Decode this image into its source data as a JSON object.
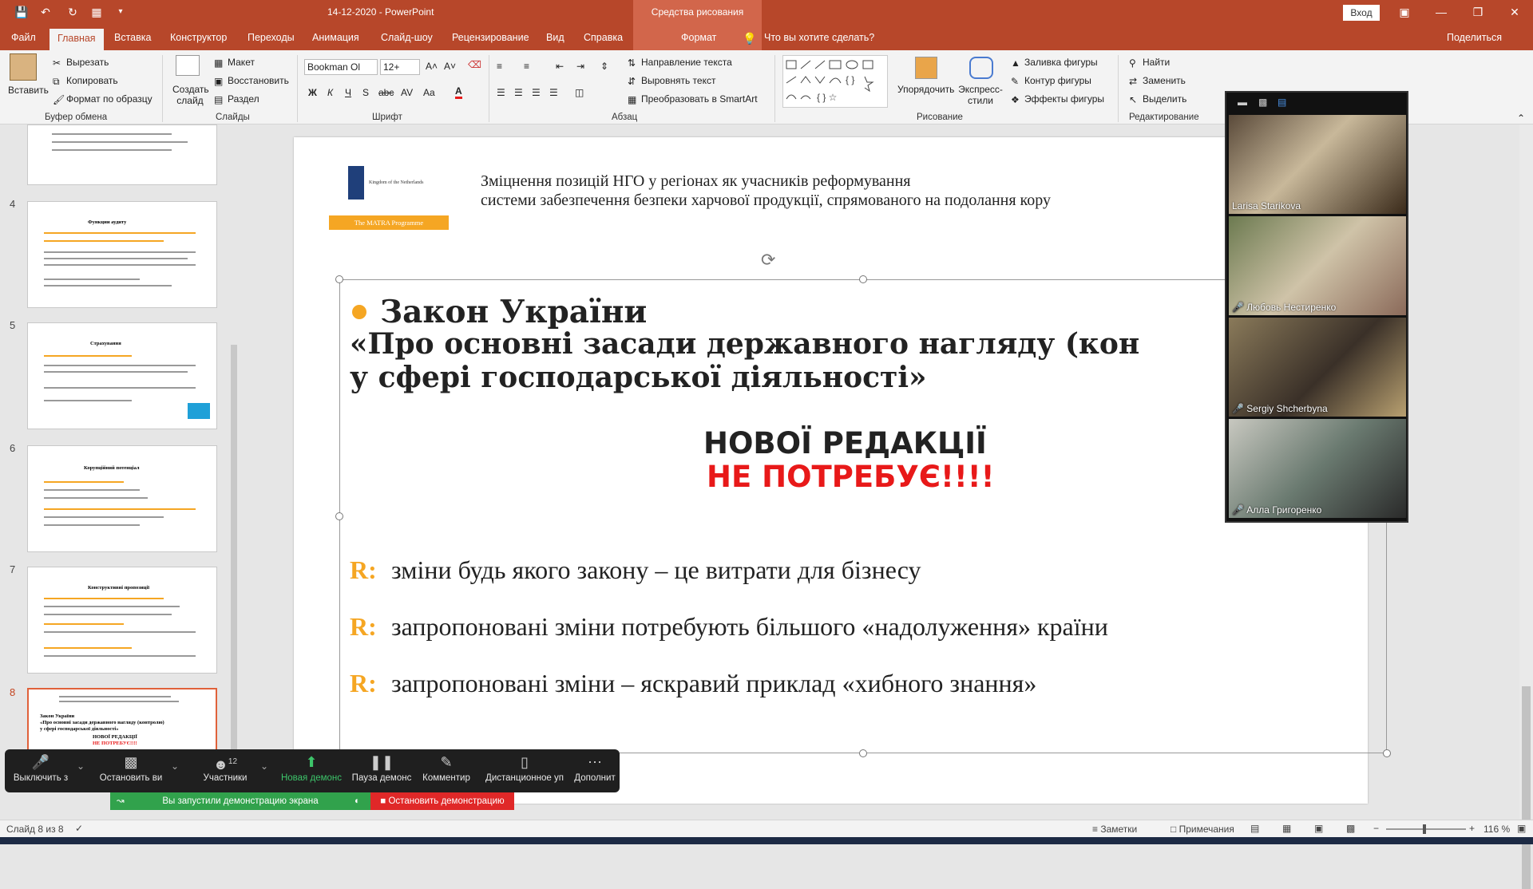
{
  "window": {
    "title": "14-12-2020  -  PowerPoint",
    "context_tab": "Средства рисования",
    "login": "Вход"
  },
  "menu": {
    "tabs": [
      "Файл",
      "Главная",
      "Вставка",
      "Конструктор",
      "Переходы",
      "Анимация",
      "Слайд-шоу",
      "Рецензирование",
      "Вид",
      "Справка"
    ],
    "format": "Формат",
    "tell_me": "Что вы хотите сделать?",
    "share": "Поделиться"
  },
  "ribbon": {
    "paste": "Вставить",
    "cut": "Вырезать",
    "copy": "Копировать",
    "format_painter": "Формат по образцу",
    "clipboard": "Буфер обмена",
    "new_slide": "Создать слайд",
    "layout": "Макет",
    "reset": "Восстановить",
    "section": "Раздел",
    "slides": "Слайды",
    "font_name": "Bookman Ol",
    "font_size": "12+",
    "font": "Шрифт",
    "text_direction": "Направление текста",
    "align_text": "Выровнять текст",
    "smartart": "Преобразовать в SmartArt",
    "paragraph": "Абзац",
    "arrange": "Упорядочить",
    "quick_styles": "Экспресс-стили",
    "shape_fill": "Заливка фигуры",
    "shape_outline": "Контур фигуры",
    "shape_effects": "Эффекты фигуры",
    "drawing": "Рисование",
    "find": "Найти",
    "replace": "Заменить",
    "select": "Выделить",
    "editing": "Редактирование"
  },
  "thumbnails": [
    {
      "num": "4",
      "title": "Функции аудиту"
    },
    {
      "num": "5",
      "title": "Страхування"
    },
    {
      "num": "6",
      "title": "Корупційний потенціал"
    },
    {
      "num": "7",
      "title": "Конструктивні пропозиції"
    },
    {
      "num": "8",
      "title": "Закон України"
    }
  ],
  "thumb8": {
    "line1": "Закон України",
    "line2": "«Про основні засади державного нагляду (контролю)",
    "line3": "у сфері господарської діяльності»",
    "line4": "НОВОЇ РЕДАКЦІЇ",
    "line5": "НЕ ПОТРЕБУЄ!!!!"
  },
  "slide": {
    "logo_text": "Kingdom of the Netherlands",
    "matra": "The MATRA Programme",
    "header_line1": "Зміцнення позицій НГО у регіонах як учасників реформування",
    "header_line2": "системи забезпечення безпеки харчової продукції, спрямованого на подолання кору",
    "law_title": "Закон України",
    "law_line2": "«Про основні засади державного нагляду (кон",
    "law_line3": "у сфері господарської діяльності»",
    "new_edition": "НОВОЇ РЕДАКЦІЇ",
    "not_needed": "НЕ ПОТРЕБУЄ!!!!",
    "r_marker": "R:",
    "r1": "зміни будь якого закону – це витрати для бізнесу",
    "r2": "запропоновані зміни потребують більшого «надолуження» країни",
    "r3": "запропоновані зміни – яскравий приклад «хибного знання»"
  },
  "zoom": {
    "mute": "Выключить з",
    "stop_video": "Остановить ви",
    "participants": "Участники",
    "participants_count": "12",
    "new_share": "Новая демонс",
    "pause_share": "Пауза демонс",
    "annotate": "Комментир",
    "remote": "Дистанционное уп",
    "more": "Дополнит",
    "banner": "Вы запустили демонстрацию экрана",
    "stop_share": "Остановить демонстрацию"
  },
  "participants": [
    {
      "name": "Larisa Starikova"
    },
    {
      "name": "Любовь Нестиренко"
    },
    {
      "name": "Sergiy Shcherbyna"
    },
    {
      "name": "Алла Григоренко"
    }
  ],
  "status": {
    "slide_of": "Слайд 8 из 8",
    "notes": "Заметки",
    "comments": "Примечания",
    "zoom_level": "116 %"
  },
  "colors": {
    "accent": "#b7472a",
    "context": "#d2664b",
    "orange": "#f5a623",
    "red": "#e81919"
  }
}
